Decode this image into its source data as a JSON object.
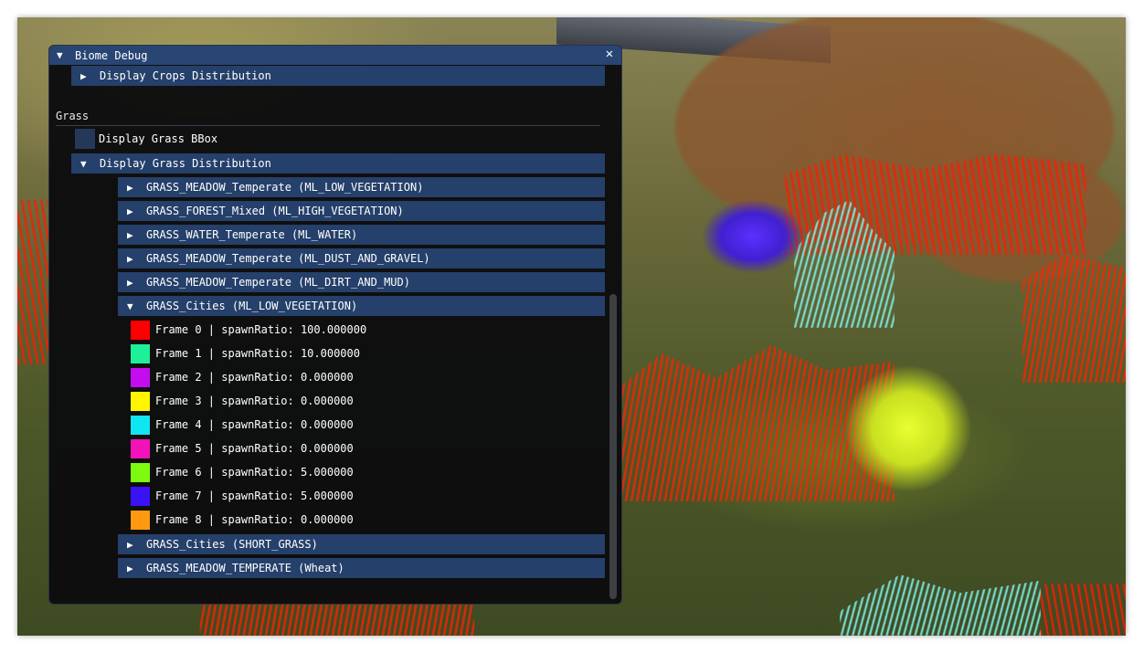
{
  "window": {
    "title": "Biome Debug"
  },
  "top_item": {
    "label": "Display Crops Distribution"
  },
  "section": {
    "label": "Grass"
  },
  "checkbox_item": {
    "label": "Display Grass BBox"
  },
  "distribution": {
    "label": "Display Grass Distribution"
  },
  "groups_before": [
    {
      "label": "GRASS_MEADOW_Temperate (ML_LOW_VEGETATION)"
    },
    {
      "label": "GRASS_FOREST_Mixed (ML_HIGH_VEGETATION)"
    },
    {
      "label": "GRASS_WATER_Temperate (ML_WATER)"
    },
    {
      "label": "GRASS_MEADOW_Temperate (ML_DUST_AND_GRAVEL)"
    },
    {
      "label": "GRASS_MEADOW_Temperate (ML_DIRT_AND_MUD)"
    }
  ],
  "expanded_group": {
    "label": "GRASS_Cities (ML_LOW_VEGETATION)",
    "frames": [
      {
        "label": "Frame 0 | spawnRatio: 100.000000",
        "color": "#ff0000"
      },
      {
        "label": "Frame 1 | spawnRatio: 10.000000",
        "color": "#1ef09a"
      },
      {
        "label": "Frame 2 | spawnRatio: 0.000000",
        "color": "#c40cf0"
      },
      {
        "label": "Frame 3 | spawnRatio: 0.000000",
        "color": "#fff500"
      },
      {
        "label": "Frame 4 | spawnRatio: 0.000000",
        "color": "#10e5f2"
      },
      {
        "label": "Frame 5 | spawnRatio: 0.000000",
        "color": "#f212b8"
      },
      {
        "label": "Frame 6 | spawnRatio: 5.000000",
        "color": "#7dfa10"
      },
      {
        "label": "Frame 7 | spawnRatio: 5.000000",
        "color": "#3a12f5"
      },
      {
        "label": "Frame 8 | spawnRatio: 0.000000",
        "color": "#ff9a10"
      }
    ]
  },
  "groups_after": [
    {
      "label": "GRASS_Cities (SHORT_GRASS)"
    },
    {
      "label": "GRASS_MEADOW_TEMPERATE (Wheat)"
    }
  ],
  "colors": {
    "titlebar": "#284573",
    "header_row": "#25406a",
    "window_bg": "#0c0c0e"
  }
}
